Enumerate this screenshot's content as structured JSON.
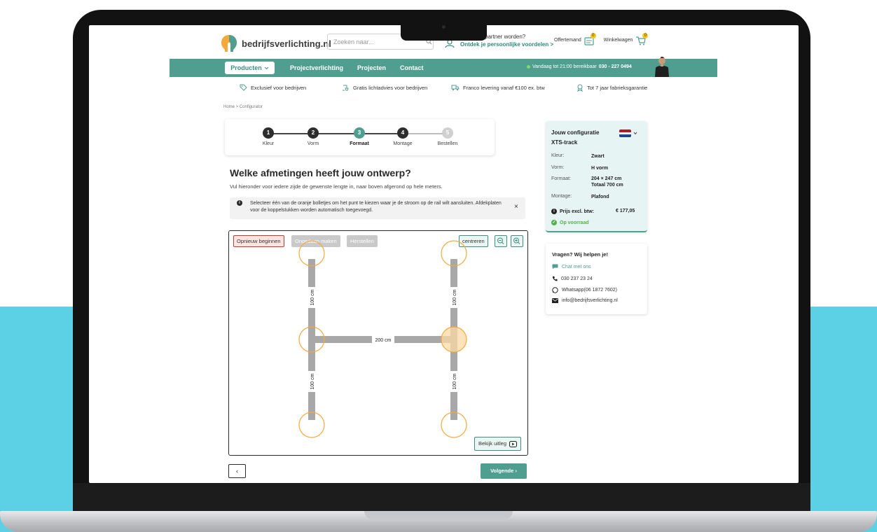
{
  "header": {
    "logo_text": "bedrijfsverlichting.nl",
    "search_placeholder": "Zoeken naar...",
    "partner_line1": "spartner worden?",
    "partner_line2": "Ontdek je persoonlijke voordelen  >",
    "quote_label": "Offertemand",
    "quote_count": "0",
    "cart_label": "Winkelwagen",
    "cart_count": "0"
  },
  "nav": {
    "products_label": "Producten",
    "links": [
      "Projectverlichting",
      "Projecten",
      "Contact"
    ],
    "availability": "Vandaag tot 21:00 bereikbaar",
    "phone": "030 - 227 0494"
  },
  "usps": [
    {
      "icon": "tag-icon",
      "label": "Exclusief voor bedrijven"
    },
    {
      "icon": "lamp-icon",
      "label": "Gratis lichtadvies voor bedrijven"
    },
    {
      "icon": "truck-icon",
      "label": "Franco levering vanaf €100 ex. btw"
    },
    {
      "icon": "award-icon",
      "label": "Tot 7 jaar fabrieksgarantie"
    }
  ],
  "breadcrumb": "Home  >  Configurator",
  "steps": [
    {
      "num": "1",
      "label": "Kleur",
      "state": "done"
    },
    {
      "num": "2",
      "label": "Vorm",
      "state": "done"
    },
    {
      "num": "3",
      "label": "Formaat",
      "state": "active"
    },
    {
      "num": "4",
      "label": "Montage",
      "state": "todo"
    },
    {
      "num": "5",
      "label": "Bestellen",
      "state": "disabled"
    }
  ],
  "main": {
    "heading": "Welke afmetingen heeft jouw ontwerp?",
    "subtext": "Vul hieronder voor iedere zijde de gewenste lengte in, naar boven afgerond op hele meters.",
    "info": "Selecteer één van de oranje bolletjes om het punt te kiezen waar je de stroom op de rail wilt aansluiten. Afdekplaten voor de koppelstukken worden automatisch toegevoegd.",
    "info_close": "×"
  },
  "editor": {
    "restart": "Opnieuw beginnen",
    "undo": "Ongedaan maken",
    "redo": "Herstellen",
    "center": "centreren",
    "explain": "Bekijk uitleg",
    "segments": [
      {
        "label": "100 cm"
      },
      {
        "label": "100 cm"
      },
      {
        "label": "100 cm"
      },
      {
        "label": "100 cm"
      },
      {
        "label": "200 cm"
      }
    ]
  },
  "footer_nav": {
    "back": "‹",
    "next": "Volgende  ›"
  },
  "config": {
    "title_line1": "Jouw configuratie",
    "title_line2": "XTS-track",
    "rows": [
      {
        "label": "Kleur:",
        "value": "Zwart"
      },
      {
        "label": "Vorm:",
        "value": "H vorm"
      },
      {
        "label": "Formaat:",
        "value": "204 × 247 cm",
        "value2": "Totaal 700 cm"
      },
      {
        "label": "Montage:",
        "value": "Plafond"
      }
    ],
    "price_label": "Prijs excl. btw:",
    "price_value": "€ 177,05",
    "stock": "Op voorraad"
  },
  "help": {
    "title": "Vragen? Wij helpen je!",
    "chat": "Chat met ons",
    "phone": "030 237 23 24",
    "whatsapp": "Whatsapp(06 1872 7602)",
    "email": "info@bedrijfsverlichting.nl"
  },
  "colors": {
    "brand": "#4f9e90",
    "accent_orange": "#f5a93b",
    "background_band": "#5cd0e4"
  }
}
